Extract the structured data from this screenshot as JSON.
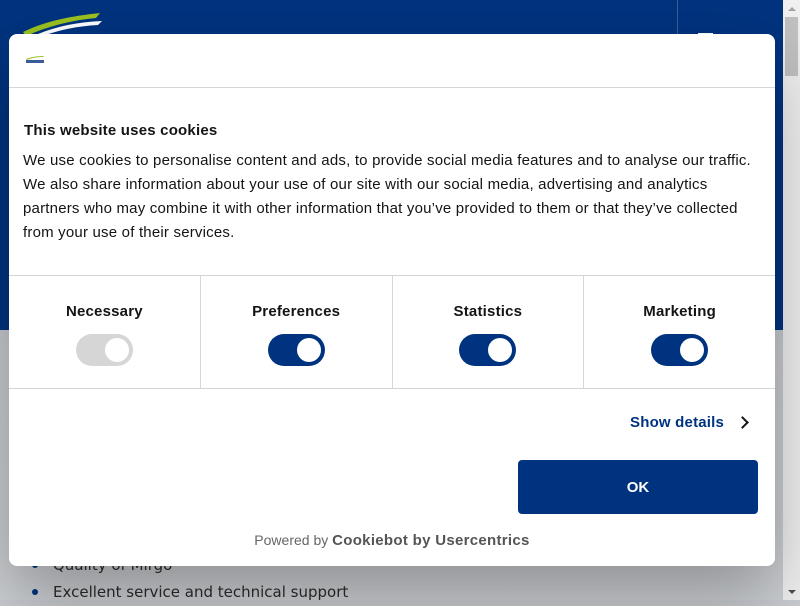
{
  "page": {
    "list_items": [
      "Quality of Mirgo",
      "Excellent service and technical support"
    ]
  },
  "colors": {
    "brand_blue": "#00337f",
    "logo_green": "#9bc21f",
    "toggle_off": "#d6d6d6"
  },
  "dialog": {
    "title": "This website uses cookies",
    "description": "We use cookies to personalise content and ads, to provide social media features and to analyse our traffic. We also share information about your use of our site with our social media, advertising and analytics partners who may combine it with other information that you’ve provided to them or that they’ve collected from your use of their services.",
    "categories": [
      {
        "label": "Necessary",
        "enabled": true,
        "disabled": true
      },
      {
        "label": "Preferences",
        "enabled": true,
        "disabled": false
      },
      {
        "label": "Statistics",
        "enabled": true,
        "disabled": false
      },
      {
        "label": "Marketing",
        "enabled": true,
        "disabled": false
      }
    ],
    "show_details_label": "Show details",
    "ok_label": "OK",
    "powered_by_prefix": "Powered by",
    "powered_by_brand": "Cookiebot by Usercentrics"
  }
}
